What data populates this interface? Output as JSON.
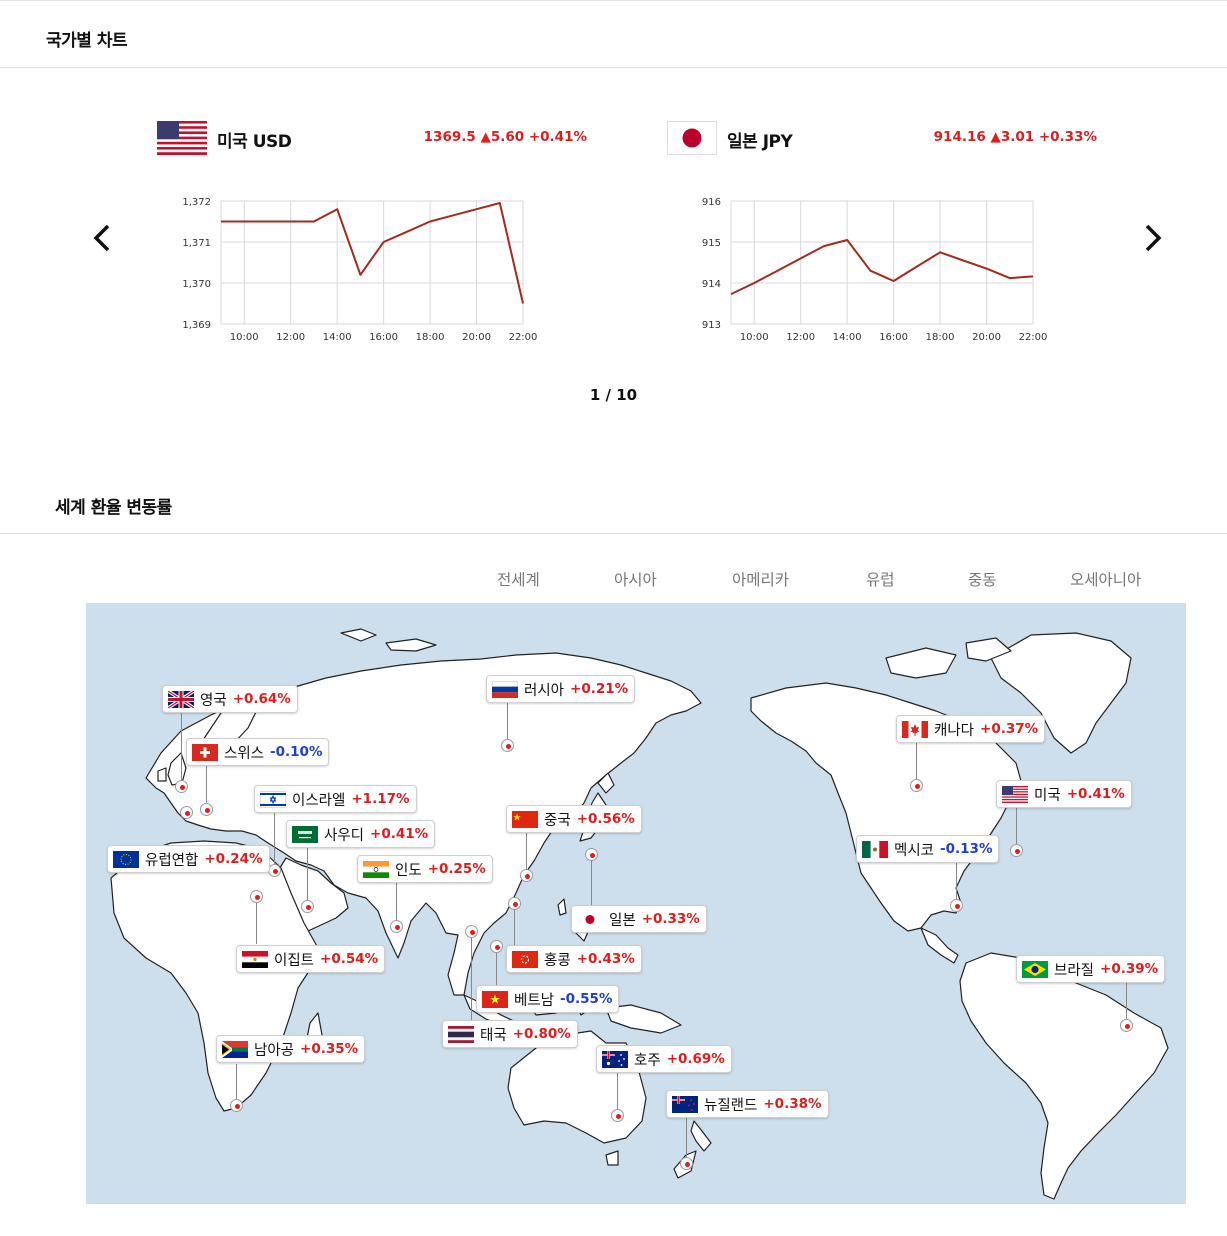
{
  "section1": {
    "title": "국가별 차트"
  },
  "section2": {
    "title": "세계 환율 변동률"
  },
  "pager": {
    "text": "1 / 10"
  },
  "cards": [
    {
      "id": "usd",
      "name": "미국 USD",
      "quote": "1369.5 ▲5.60 +0.41%",
      "flag": "us-flag",
      "chart_data": {
        "type": "line",
        "x": [
          "09:00",
          "10:00",
          "11:00",
          "12:00",
          "13:00",
          "14:00",
          "15:00",
          "16:00",
          "17:00",
          "18:00",
          "19:00",
          "20:00",
          "21:00",
          "22:00"
        ],
        "xticks": [
          "10:00",
          "12:00",
          "14:00",
          "16:00",
          "18:00",
          "20:00",
          "22:00"
        ],
        "values": [
          1371.5,
          1371.5,
          1371.5,
          1371.5,
          1371.5,
          1371.8,
          1370.2,
          1371.0,
          1371.25,
          1371.5,
          1371.65,
          1371.8,
          1371.95,
          1369.5
        ],
        "yticks": [
          "1,369",
          "1,370",
          "1,371",
          "1,372"
        ],
        "ylim": [
          1369,
          1372
        ],
        "color": "#a52a1e"
      }
    },
    {
      "id": "jpy",
      "name": "일본 JPY",
      "quote": "914.16 ▲3.01 +0.33%",
      "flag": "jp-flag",
      "chart_data": {
        "type": "line",
        "x": [
          "09:00",
          "10:00",
          "11:00",
          "12:00",
          "13:00",
          "14:00",
          "15:00",
          "16:00",
          "17:00",
          "18:00",
          "19:00",
          "20:00",
          "21:00",
          "22:00"
        ],
        "xticks": [
          "10:00",
          "12:00",
          "14:00",
          "16:00",
          "18:00",
          "20:00",
          "22:00"
        ],
        "values": [
          913.73,
          914.0,
          914.3,
          914.6,
          914.9,
          915.05,
          914.3,
          914.05,
          914.4,
          914.75,
          914.55,
          914.35,
          914.12,
          914.16
        ],
        "yticks": [
          "913",
          "914",
          "915",
          "916"
        ],
        "ylim": [
          913,
          916
        ],
        "color": "#a52a1e"
      }
    }
  ],
  "regions": [
    "전세계",
    "아시아",
    "아메리카",
    "유럽",
    "중동",
    "오세아니아"
  ],
  "markers": [
    {
      "id": "uk",
      "name": "영국",
      "change": "+0.64%",
      "dir": "up",
      "flag": "uk"
    },
    {
      "id": "ch",
      "name": "스위스",
      "change": "-0.10%",
      "dir": "down",
      "flag": "ch"
    },
    {
      "id": "il",
      "name": "이스라엘",
      "change": "+1.17%",
      "dir": "up",
      "flag": "il"
    },
    {
      "id": "sa",
      "name": "사우디",
      "change": "+0.41%",
      "dir": "up",
      "flag": "sa"
    },
    {
      "id": "eu",
      "name": "유럽연합",
      "change": "+0.24%",
      "dir": "up",
      "flag": "eu"
    },
    {
      "id": "in",
      "name": "인도",
      "change": "+0.25%",
      "dir": "up",
      "flag": "in"
    },
    {
      "id": "eg",
      "name": "이집트",
      "change": "+0.54%",
      "dir": "up",
      "flag": "eg"
    },
    {
      "id": "za",
      "name": "남아공",
      "change": "+0.35%",
      "dir": "up",
      "flag": "za"
    },
    {
      "id": "ru",
      "name": "러시아",
      "change": "+0.21%",
      "dir": "up",
      "flag": "ru"
    },
    {
      "id": "cn",
      "name": "중국",
      "change": "+0.56%",
      "dir": "up",
      "flag": "cn"
    },
    {
      "id": "jp",
      "name": "일본",
      "change": "+0.33%",
      "dir": "up",
      "flag": "jp"
    },
    {
      "id": "hk",
      "name": "홍콩",
      "change": "+0.43%",
      "dir": "up",
      "flag": "hk"
    },
    {
      "id": "vn",
      "name": "베트남",
      "change": "-0.55%",
      "dir": "down",
      "flag": "vn"
    },
    {
      "id": "th",
      "name": "태국",
      "change": "+0.80%",
      "dir": "up",
      "flag": "th"
    },
    {
      "id": "au",
      "name": "호주",
      "change": "+0.69%",
      "dir": "up",
      "flag": "au"
    },
    {
      "id": "nz",
      "name": "뉴질랜드",
      "change": "+0.38%",
      "dir": "up",
      "flag": "nz"
    },
    {
      "id": "ca",
      "name": "캐나다",
      "change": "+0.37%",
      "dir": "up",
      "flag": "ca"
    },
    {
      "id": "us",
      "name": "미국",
      "change": "+0.41%",
      "dir": "up",
      "flag": "us"
    },
    {
      "id": "mx",
      "name": "멕시코",
      "change": "-0.13%",
      "dir": "down",
      "flag": "mx"
    },
    {
      "id": "br",
      "name": "브라질",
      "change": "+0.39%",
      "dir": "up",
      "flag": "br"
    }
  ],
  "colors": {
    "up": "#e01c1c",
    "down": "#1e3fd6",
    "line": "#a52a1e",
    "ocean": "#cddfec"
  }
}
